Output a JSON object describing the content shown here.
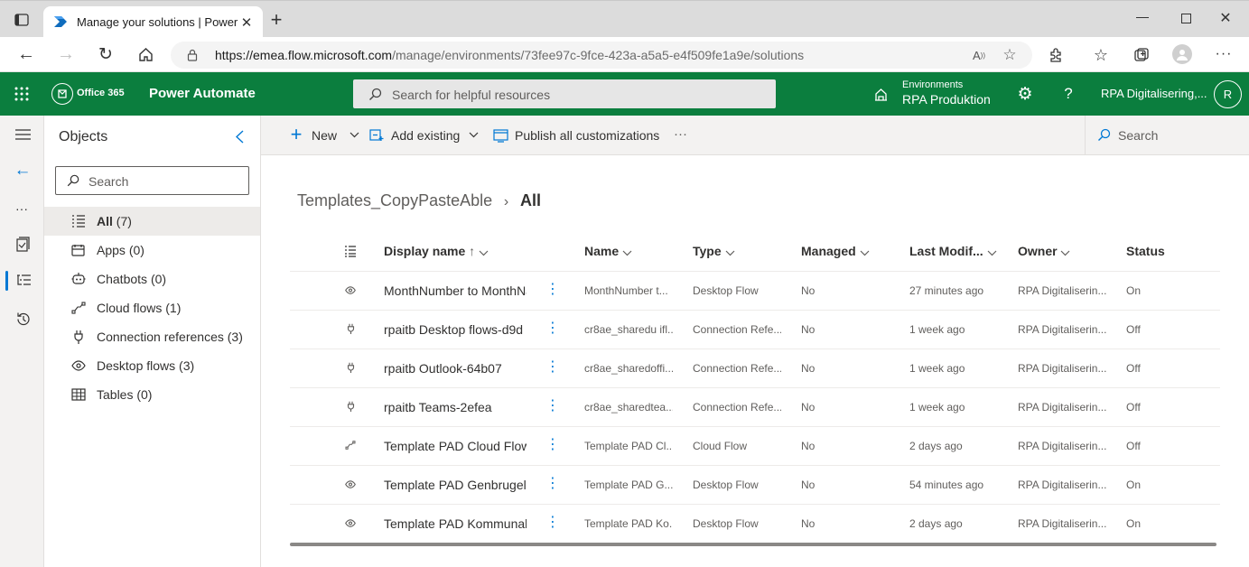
{
  "browser": {
    "tab_title": "Manage your solutions | Power Automate",
    "url_host": "https://emea.flow.microsoft.com",
    "url_path": "/manage/environments/73fee97c-9fce-423a-a5a5-e4f509fe1a9e/solutions"
  },
  "header": {
    "office_label": "Office 365",
    "app_name": "Power Automate",
    "search_placeholder": "Search for helpful resources",
    "env_label": "Environments",
    "env_name": "RPA Produktion",
    "user_name": "RPA Digitalisering,...",
    "avatar_initial": "R"
  },
  "objects_panel": {
    "title": "Objects",
    "search_placeholder": "Search",
    "items": [
      {
        "label": "All",
        "count": "(7)"
      },
      {
        "label": "Apps",
        "count": "(0)"
      },
      {
        "label": "Chatbots",
        "count": "(0)"
      },
      {
        "label": "Cloud flows",
        "count": "(1)"
      },
      {
        "label": "Connection references",
        "count": "(3)"
      },
      {
        "label": "Desktop flows",
        "count": "(3)"
      },
      {
        "label": "Tables",
        "count": "(0)"
      }
    ]
  },
  "commandbar": {
    "new": "New",
    "add_existing": "Add existing",
    "publish": "Publish all customizations",
    "more": "···",
    "search": "Search"
  },
  "breadcrumb": {
    "parent": "Templates_CopyPasteAble",
    "current": "All"
  },
  "table": {
    "headers": {
      "display_name": "Display name",
      "name": "Name",
      "type": "Type",
      "managed": "Managed",
      "last_modified": "Last Modif...",
      "owner": "Owner",
      "status": "Status"
    },
    "rows": [
      {
        "display": "MonthNumber to MonthName",
        "name": "MonthNumber t...",
        "type": "Desktop Flow",
        "managed": "No",
        "modified": "27 minutes ago",
        "owner": "RPA Digitaliserin...",
        "status": "On"
      },
      {
        "display": "rpaitb Desktop flows-d9d",
        "name": "cr8ae_sharedu ifl...",
        "type": "Connection Refe...",
        "managed": "No",
        "modified": "1 week ago",
        "owner": "RPA Digitaliserin...",
        "status": "Off"
      },
      {
        "display": "rpaitb Outlook-64b07",
        "name": "cr8ae_sharedoffi...",
        "type": "Connection Refe...",
        "managed": "No",
        "modified": "1 week ago",
        "owner": "RPA Digitaliserin...",
        "status": "Off"
      },
      {
        "display": "rpaitb Teams-2efea",
        "name": "cr8ae_sharedtea...",
        "type": "Connection Refe...",
        "managed": "No",
        "modified": "1 week ago",
        "owner": "RPA Digitaliserin...",
        "status": "Off"
      },
      {
        "display": "Template PAD Cloud Flow",
        "name": "Template PAD Cl...",
        "type": "Cloud Flow",
        "managed": "No",
        "modified": "2 days ago",
        "owner": "RPA Digitaliserin...",
        "status": "Off"
      },
      {
        "display": "Template PAD Genbrugeligt",
        "name": "Template PAD G...",
        "type": "Desktop Flow",
        "managed": "No",
        "modified": "54 minutes ago",
        "owner": "RPA Digitaliserin...",
        "status": "On"
      },
      {
        "display": "Template PAD Kommunal",
        "name": "Template PAD Ko...",
        "type": "Desktop Flow",
        "managed": "No",
        "modified": "2 days ago",
        "owner": "RPA Digitaliserin...",
        "status": "On"
      }
    ]
  },
  "colors": {
    "brand": "#0b7e3e",
    "accent": "#0078d4"
  }
}
